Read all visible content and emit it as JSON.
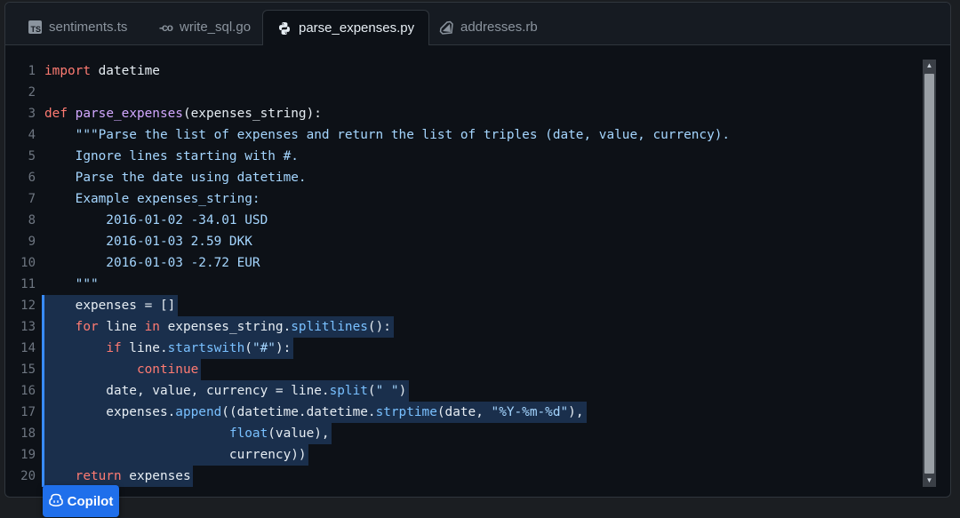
{
  "tabs": [
    {
      "label": "sentiments.ts",
      "icon": "typescript-icon",
      "active": false
    },
    {
      "label": "write_sql.go",
      "icon": "go-icon",
      "active": false
    },
    {
      "label": "parse_expenses.py",
      "icon": "python-icon",
      "active": true
    },
    {
      "label": "addresses.rb",
      "icon": "ruby-icon",
      "active": false
    }
  ],
  "icons": {
    "ts_badge": "TS",
    "go_badge": "-co"
  },
  "colors": {
    "keyword": "#ff7b72",
    "function": "#d2a8ff",
    "string": "#a5d6ff",
    "method": "#79c0ff",
    "selection": "#1f3a5f",
    "accent": "#1f6feb"
  },
  "code_lines": [
    {
      "n": "1",
      "tokens": [
        [
          "kw",
          "import"
        ],
        [
          "plain",
          " datetime"
        ]
      ]
    },
    {
      "n": "2",
      "tokens": []
    },
    {
      "n": "3",
      "tokens": [
        [
          "kw",
          "def"
        ],
        [
          "plain",
          " "
        ],
        [
          "fn",
          "parse_expenses"
        ],
        [
          "plain",
          "(expenses_string):"
        ]
      ]
    },
    {
      "n": "4",
      "tokens": [
        [
          "str",
          "    \"\"\"Parse the list of expenses and return the list of triples (date, value, currency)."
        ]
      ]
    },
    {
      "n": "5",
      "tokens": [
        [
          "str",
          "    Ignore lines starting with #."
        ]
      ]
    },
    {
      "n": "6",
      "tokens": [
        [
          "str",
          "    Parse the date using datetime."
        ]
      ]
    },
    {
      "n": "7",
      "tokens": [
        [
          "str",
          "    Example expenses_string:"
        ]
      ]
    },
    {
      "n": "8",
      "tokens": [
        [
          "str",
          "        2016-01-02 -34.01 USD"
        ]
      ]
    },
    {
      "n": "9",
      "tokens": [
        [
          "str",
          "        2016-01-03 2.59 DKK"
        ]
      ]
    },
    {
      "n": "10",
      "tokens": [
        [
          "str",
          "        2016-01-03 -2.72 EUR"
        ]
      ]
    },
    {
      "n": "11",
      "tokens": [
        [
          "str",
          "    \"\"\""
        ]
      ]
    },
    {
      "n": "12",
      "tokens": [
        [
          "plain",
          "    expenses = []"
        ]
      ],
      "sel": 1
    },
    {
      "n": "13",
      "tokens": [
        [
          "plain",
          "    "
        ],
        [
          "kw",
          "for"
        ],
        [
          "plain",
          " line "
        ],
        [
          "kw",
          "in"
        ],
        [
          "plain",
          " expenses_string."
        ],
        [
          "mth",
          "splitlines"
        ],
        [
          "plain",
          "():"
        ]
      ],
      "sel": 1
    },
    {
      "n": "14",
      "tokens": [
        [
          "plain",
          "        "
        ],
        [
          "kw",
          "if"
        ],
        [
          "plain",
          " line."
        ],
        [
          "mth",
          "startswith"
        ],
        [
          "plain",
          "("
        ],
        [
          "str",
          "\"#\""
        ],
        [
          "plain",
          "):"
        ]
      ],
      "sel": 1
    },
    {
      "n": "15",
      "tokens": [
        [
          "plain",
          "            "
        ],
        [
          "kw",
          "continue"
        ]
      ],
      "sel": 1
    },
    {
      "n": "16",
      "tokens": [
        [
          "plain",
          "        date, value, currency = line."
        ],
        [
          "mth",
          "split"
        ],
        [
          "plain",
          "("
        ],
        [
          "str",
          "\" \""
        ],
        [
          "plain",
          ")"
        ]
      ],
      "sel": 1
    },
    {
      "n": "17",
      "tokens": [
        [
          "plain",
          "        expenses."
        ],
        [
          "mth",
          "append"
        ],
        [
          "plain",
          "((datetime.datetime."
        ],
        [
          "mth",
          "strptime"
        ],
        [
          "plain",
          "(date, "
        ],
        [
          "str",
          "\"%Y-%m-%d\""
        ],
        [
          "plain",
          "),"
        ]
      ],
      "sel": 1
    },
    {
      "n": "18",
      "tokens": [
        [
          "plain",
          "                        "
        ],
        [
          "mth",
          "float"
        ],
        [
          "plain",
          "(value),"
        ]
      ],
      "sel": 1
    },
    {
      "n": "19",
      "tokens": [
        [
          "plain",
          "                        currency))"
        ]
      ],
      "sel": 1
    },
    {
      "n": "20",
      "tokens": [
        [
          "plain",
          "    "
        ],
        [
          "kw",
          "return"
        ],
        [
          "plain",
          " expenses"
        ]
      ],
      "sel": 1
    }
  ],
  "copilot": {
    "label": "Copilot",
    "icon": "copilot-icon"
  }
}
